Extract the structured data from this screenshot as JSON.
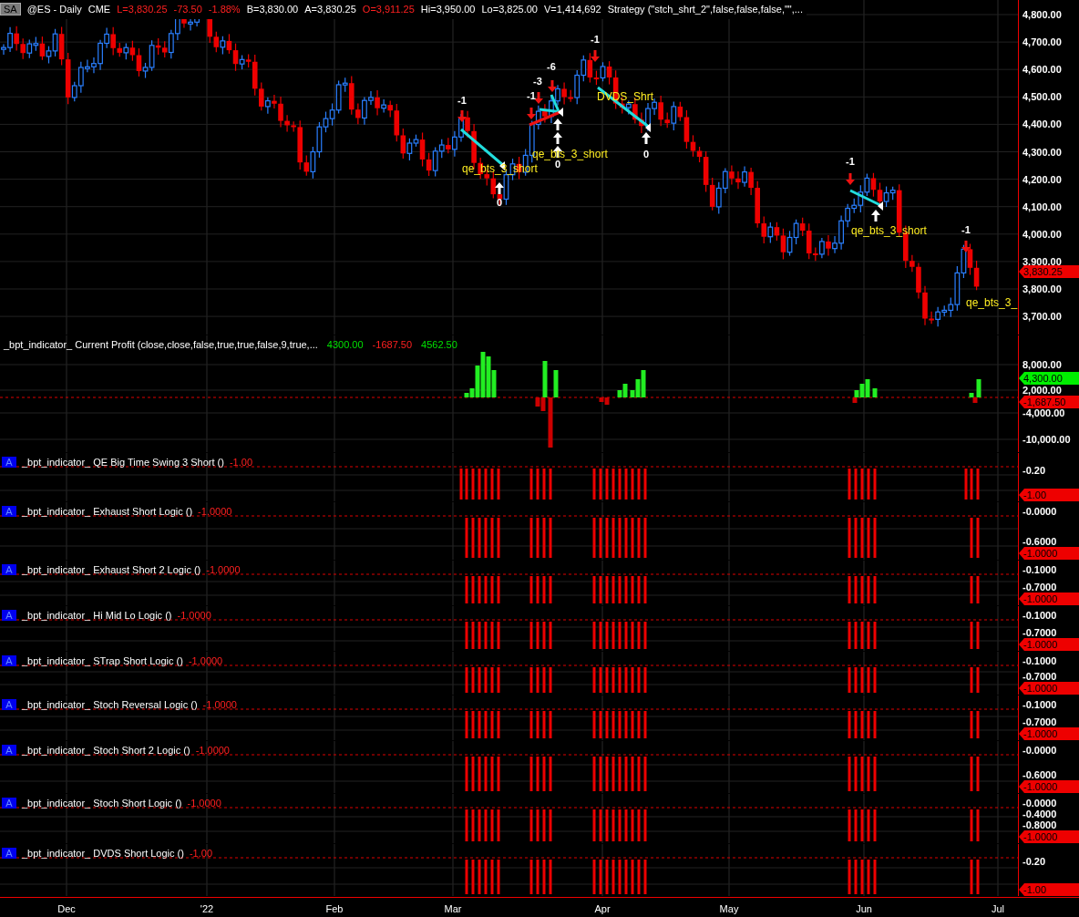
{
  "header": {
    "symbol_badge": "SA",
    "fields": [
      {
        "text": "@ES - Daily",
        "color": "#ffffff"
      },
      {
        "text": "CME",
        "color": "#ffffff"
      },
      {
        "text": "L=3,830.25",
        "color": "#ff2020"
      },
      {
        "text": "-73.50",
        "color": "#ff2020"
      },
      {
        "text": "-1.88%",
        "color": "#ff2020"
      },
      {
        "text": "B=3,830.00",
        "color": "#ffffff"
      },
      {
        "text": "A=3,830.25",
        "color": "#ffffff"
      },
      {
        "text": "O=3,911.25",
        "color": "#ff2020"
      },
      {
        "text": "Hi=3,950.00",
        "color": "#ffffff"
      },
      {
        "text": "Lo=3,825.00",
        "color": "#ffffff"
      },
      {
        "text": "V=1,414,692",
        "color": "#ffffff"
      },
      {
        "text": "Strategy (\"stch_shrt_2\",false,false,false,\"\",...",
        "color": "#ffffff"
      }
    ]
  },
  "price_panel": {
    "annotations": [
      {
        "text": "-1",
        "kind": "count"
      },
      {
        "text": "-1",
        "kind": "count"
      },
      {
        "text": "-3",
        "kind": "count"
      },
      {
        "text": "-6",
        "kind": "count"
      },
      {
        "text": "-1",
        "kind": "count"
      },
      {
        "text": "-1",
        "kind": "count"
      },
      {
        "text": "-1",
        "kind": "count"
      },
      {
        "text": "0",
        "kind": "count"
      },
      {
        "text": "0",
        "kind": "count"
      },
      {
        "text": "0",
        "kind": "count"
      },
      {
        "text": "qe_bts_3_short",
        "kind": "label"
      },
      {
        "text": "qe_bts_3_short",
        "kind": "label"
      },
      {
        "text": "DVDS_Shrt",
        "kind": "label"
      },
      {
        "text": "qe_bts_3_short",
        "kind": "label"
      },
      {
        "text": "qe_bts_3_",
        "kind": "label"
      }
    ],
    "axis": {
      "ticks": [
        "4,800.00",
        "4,700.00",
        "4,600.00",
        "4,500.00",
        "4,400.00",
        "4,300.00",
        "4,200.00",
        "4,100.00",
        "4,000.00",
        "3,900.00",
        "3,800.00",
        "3,700.00"
      ],
      "marker": {
        "text": "3,830.25",
        "color": "#ee0000"
      }
    }
  },
  "profit_panel": {
    "title": "_bpt_indicator_ Current Profit (close,close,false,true,true,false,9,true,...",
    "values": [
      {
        "text": "4300.00",
        "color": "#00e000"
      },
      {
        "text": "-1687.50",
        "color": "#ff2020"
      },
      {
        "text": "4562.50",
        "color": "#00e000"
      }
    ],
    "axis": {
      "ticks": [
        "8,000.00",
        "2,000.00",
        "-4,000.00",
        "-10,000.00"
      ],
      "markers": [
        {
          "text": "4,300.00",
          "color": "#00ee00"
        },
        {
          "text": "-1,687.50",
          "color": "#ee0000"
        }
      ]
    }
  },
  "indicators": [
    {
      "badge": "A",
      "title": "_bpt_indicator_ QE Big Time Swing 3 Short ()",
      "value": "-1.00",
      "ticks": [
        "-0.20"
      ],
      "marker": "-1.00"
    },
    {
      "badge": "A",
      "title": "_bpt_indicator_ Exhaust Short Logic ()",
      "value": "-1.0000",
      "ticks": [
        "-0.0000",
        "-0.6000"
      ],
      "marker": "-1.0000"
    },
    {
      "badge": "A",
      "title": "_bpt_indicator_ Exhaust Short 2 Logic ()",
      "value": "-1.0000",
      "ticks": [
        "-0.1000",
        "-0.7000"
      ],
      "marker": "-1.0000"
    },
    {
      "badge": "A",
      "title": "_bpt_indicator_ Hi Mid Lo Logic ()",
      "value": "-1.0000",
      "ticks": [
        "-0.1000",
        "-0.7000"
      ],
      "marker": "-1.0000"
    },
    {
      "badge": "A",
      "title": "_bpt_indicator_ STrap Short Logic ()",
      "value": "-1.0000",
      "ticks": [
        "-0.1000",
        "-0.7000"
      ],
      "marker": "-1.0000"
    },
    {
      "badge": "A",
      "title": "_bpt_indicator_ Stoch Reversal Logic ()",
      "value": "-1.0000",
      "ticks": [
        "-0.1000",
        "-0.7000"
      ],
      "marker": "-1.0000"
    },
    {
      "badge": "A",
      "title": "_bpt_indicator_ Stoch Short 2 Logic ()",
      "value": "-1.0000",
      "ticks": [
        "-0.0000",
        "-0.6000"
      ],
      "marker": "-1.0000"
    },
    {
      "badge": "A",
      "title": "_bpt_indicator_ Stoch Short Logic ()",
      "value": "-1.0000",
      "ticks": [
        "-0.0000",
        "-0.4000",
        "-0.8000"
      ],
      "marker": "-1.0000"
    },
    {
      "badge": "A",
      "title": "_bpt_indicator_ DVDS Short Logic ()",
      "value": "-1.00",
      "ticks": [
        "-0.20"
      ],
      "marker": "-1.00"
    }
  ],
  "x_axis": [
    "Dec",
    "'22",
    "Feb",
    "Mar",
    "Apr",
    "May",
    "Jun",
    "Jul"
  ]
}
